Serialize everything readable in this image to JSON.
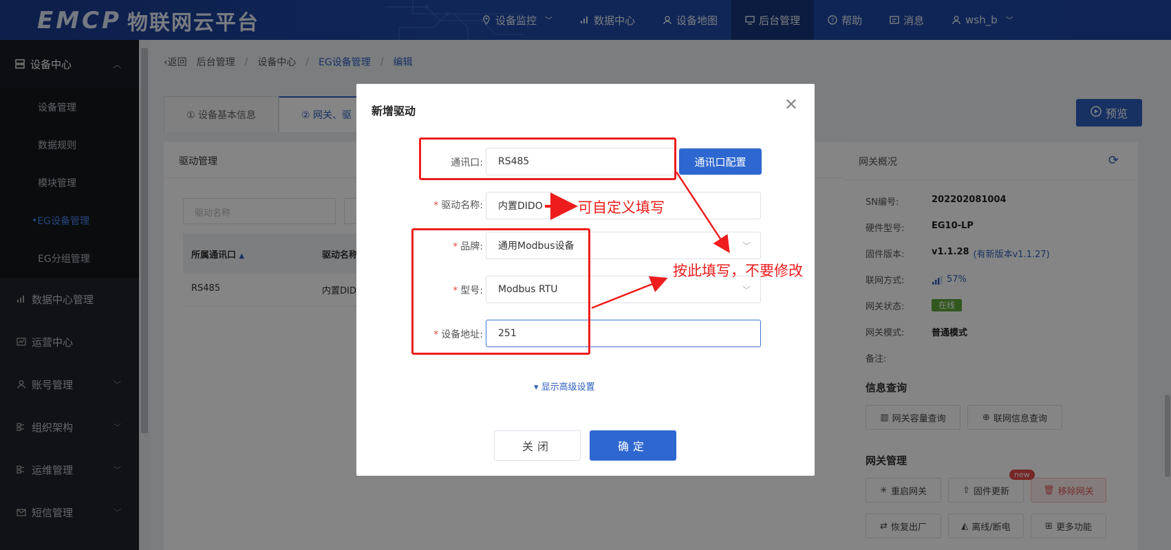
{
  "brand": {
    "logo": "EMCP",
    "title": "物联网云平台"
  },
  "nav": [
    {
      "label": "设备监控",
      "icon": "location-icon",
      "has_menu": true
    },
    {
      "label": "数据中心",
      "icon": "chart-icon",
      "has_menu": false
    },
    {
      "label": "设备地图",
      "icon": "map-user-icon",
      "has_menu": false
    },
    {
      "label": "后台管理",
      "icon": "monitor-icon",
      "has_menu": false
    },
    {
      "label": "帮助",
      "icon": "help-icon",
      "has_menu": false
    },
    {
      "label": "消息",
      "icon": "message-icon",
      "has_menu": false
    },
    {
      "label": "wsh_b",
      "icon": "user-icon",
      "has_menu": true
    }
  ],
  "sidebar": {
    "head": "设备中心",
    "sub_items": [
      "设备管理",
      "数据规则",
      "模块管理",
      "EG设备管理",
      "EG分组管理"
    ],
    "items": [
      "数据中心管理",
      "运营中心",
      "账号管理",
      "组织架构",
      "运维管理",
      "短信管理"
    ]
  },
  "breadcrumb": {
    "back": "返回",
    "items": [
      "后台管理",
      "设备中心",
      "EG设备管理",
      "编辑"
    ]
  },
  "tabs": [
    "① 设备基本信息",
    "② 网关、驱"
  ],
  "preview_label": "预览",
  "driver_panel": {
    "title": "驱动管理",
    "search_placeholder": "驱动名称",
    "columns": [
      "所属通讯口",
      "驱动名称"
    ],
    "rows": [
      [
        "RS485",
        "内置DID"
      ]
    ]
  },
  "gateway": {
    "title": "网关概况",
    "fields": [
      {
        "k": "SN编号:",
        "v": "202202081004"
      },
      {
        "k": "硬件型号:",
        "v": "EG10-LP"
      },
      {
        "k": "固件版本:",
        "v": "v1.1.28",
        "link": "(有新版本v1.1.27)"
      },
      {
        "k": "联网方式:",
        "v": "57%"
      },
      {
        "k": "网关状态:",
        "v": "在线"
      },
      {
        "k": "网关模式:",
        "v": "普通模式"
      },
      {
        "k": "备注:",
        "v": ""
      }
    ],
    "info_title": "信息查询",
    "info_buttons": [
      "网关容量查询",
      "联网信息查询"
    ],
    "manage_title": "网关管理",
    "manage_buttons": [
      "重启网关",
      "固件更新",
      "移除网关",
      "恢复出厂",
      "离线/断电",
      "更多功能"
    ],
    "new_tag": "new",
    "signal_level": 0.57
  },
  "modal": {
    "title": "新增驱动",
    "fields": [
      {
        "label": "通讯口:",
        "value": "RS485",
        "required": false,
        "type": "select"
      },
      {
        "label": "驱动名称:",
        "value": "内置DIDO",
        "required": true,
        "type": "text"
      },
      {
        "label": "品牌:",
        "value": "通用Modbus设备",
        "required": true,
        "type": "select"
      },
      {
        "label": "型号:",
        "value": "Modbus RTU",
        "required": true,
        "type": "select"
      },
      {
        "label": "设备地址:",
        "value": "251",
        "required": true,
        "type": "text"
      }
    ],
    "config_button": "通讯口配置",
    "advanced": "显示高级设置",
    "close_button": "关闭",
    "ok_button": "确定"
  },
  "annotations": {
    "custom_fill": "可自定义填写",
    "keep_as_is": "按此填写，不要修改"
  },
  "colors": {
    "primary": "#2e67d0",
    "annotation": "#ee1c1c",
    "online": "#5fa83a"
  }
}
